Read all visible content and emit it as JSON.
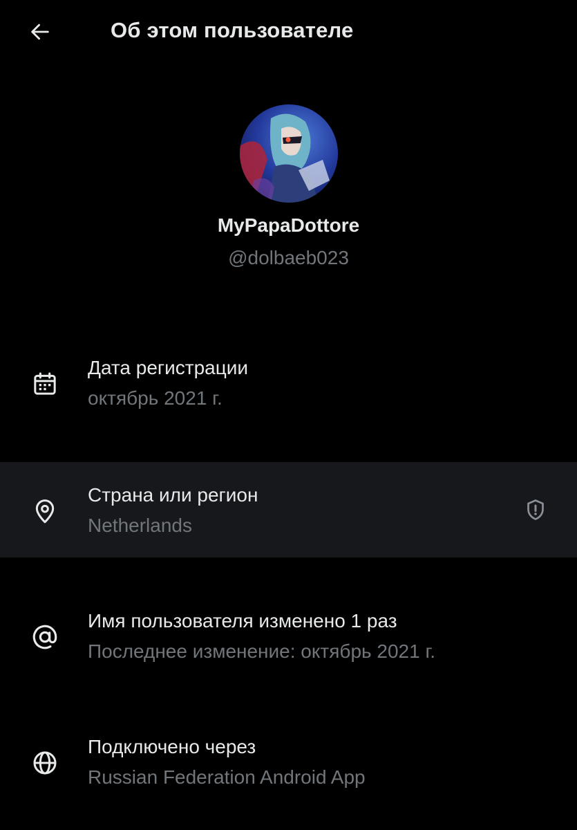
{
  "header": {
    "title": "Об этом пользователе",
    "back_icon": "arrow-left-icon"
  },
  "profile": {
    "display_name": "MyPapaDottore",
    "handle": "@dolbaeb023",
    "avatar": "anime-character-avatar"
  },
  "rows": [
    {
      "icon": "calendar-icon",
      "title": "Дата регистрации",
      "subtitle": "октябрь 2021 г."
    },
    {
      "icon": "location-pin-icon",
      "title": "Страна или регион",
      "subtitle": "Netherlands",
      "trailing_icon": "shield-alert-icon",
      "highlighted": true
    },
    {
      "icon": "at-sign-icon",
      "title": "Имя пользователя изменено 1 раз",
      "subtitle": "Последнее изменение: октябрь 2021 г."
    },
    {
      "icon": "globe-icon",
      "title": "Подключено через",
      "subtitle": "Russian Federation Android App"
    }
  ],
  "colors": {
    "background": "#000000",
    "primary_text": "#e7e9ea",
    "secondary_text": "#71767b",
    "highlight_row": "#16181c"
  }
}
